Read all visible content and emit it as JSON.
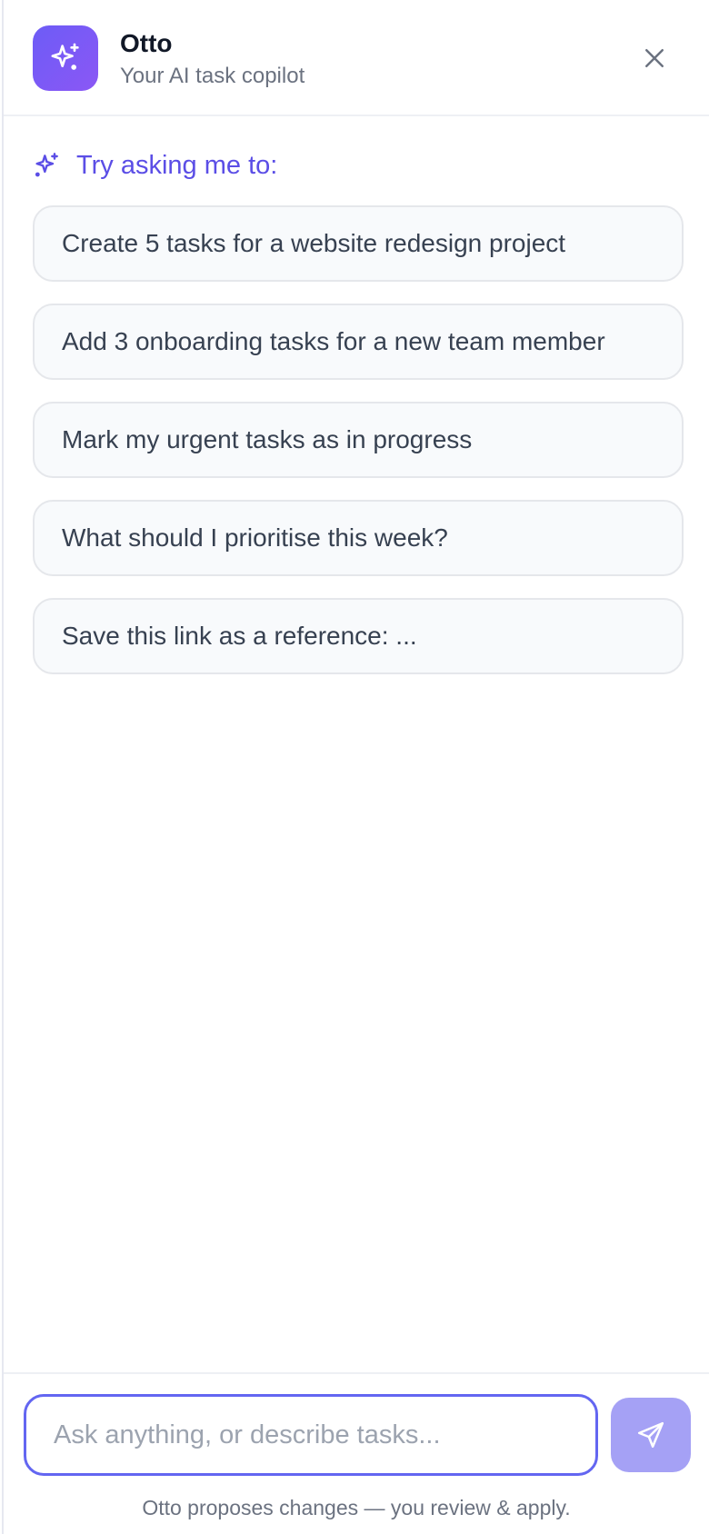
{
  "header": {
    "title": "Otto",
    "subtitle": "Your AI task copilot",
    "logo_icon": "sparkles-icon",
    "close_icon": "close-icon"
  },
  "suggestions": {
    "heading": "Try asking me to:",
    "heading_icon": "sparkles-icon",
    "items": [
      {
        "label": "Create 5 tasks for a website redesign project"
      },
      {
        "label": "Add 3 onboarding tasks for a new team member"
      },
      {
        "label": "Mark my urgent tasks as in progress"
      },
      {
        "label": "What should I prioritise this week?"
      },
      {
        "label": "Save this link as a reference: ..."
      }
    ]
  },
  "composer": {
    "placeholder": "Ask anything, or describe tasks...",
    "value": "",
    "send_icon": "send-icon",
    "disclaimer": "Otto proposes changes — you review & apply."
  },
  "colors": {
    "accent": "#6366f1",
    "logo_gradient_start": "#6d5cf6",
    "logo_gradient_end": "#8b57f5",
    "send_button": "#a5a1f5",
    "heading_text": "#5b4ee6"
  }
}
